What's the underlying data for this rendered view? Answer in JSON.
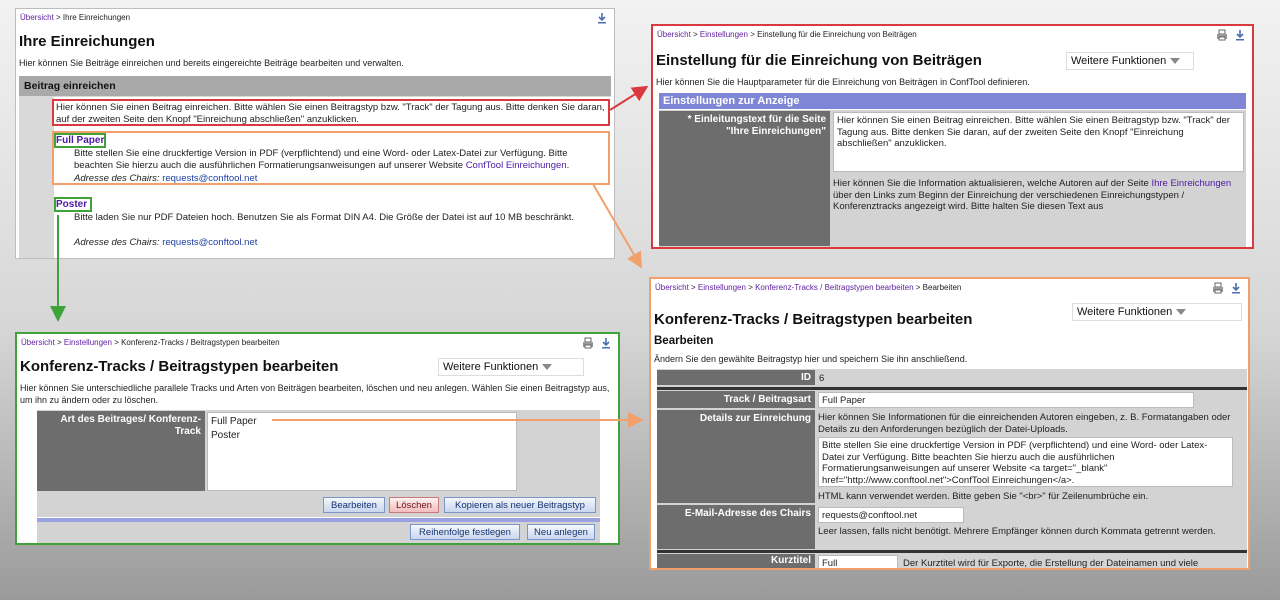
{
  "panel1": {
    "breadcrumb": {
      "home": "Übersicht",
      "current": "Ihre Einreichungen"
    },
    "title": "Ihre Einreichungen",
    "description": "Hier können Sie Beiträge einreichen und bereits eingereichte Beiträge bearbeiten und verwalten.",
    "section_header": "Beitrag einreichen",
    "intro": "Hier können Sie einen Beitrag einreichen. Bitte wählen Sie einen Beitragstyp bzw. \"Track\" der Tagung aus. Bitte denken Sie daran, auf der zweiten Seite den Knopf \"Einreichung abschließen\" anzuklicken.",
    "types": [
      {
        "name": "Full Paper",
        "text": "Bitte stellen Sie eine druckfertige Version in PDF (verpflichtend) und eine Word- oder Latex-Datei zur Verfügung. Bitte beachten Sie hierzu auch die ausführlichen Formatierungsanweisungen auf unserer Website",
        "link": "ConfTool Einreichungen",
        "chair_label": "Adresse des Chairs:",
        "email": "requests@conftool.net"
      },
      {
        "name": "Poster",
        "text": "Bitte laden Sie nur PDF Dateien hoch. Benutzen Sie als Format DIN A4. Die Größe der Datei ist auf 10 MB beschränkt.",
        "chair_label": "Adresse des Chairs:",
        "email": "requests@conftool.net"
      }
    ]
  },
  "panel2": {
    "breadcrumb": {
      "home": "Übersicht",
      "sep": ">",
      "settings": "Einstellungen",
      "current": "Einstellung für die Einreichung von Beiträgen"
    },
    "title": "Einstellung für die Einreichung von Beiträgen",
    "more": "Weitere Funktionen",
    "description": "Hier können Sie die Hauptparameter für die Einreichung von Beiträgen in ConfTool definieren.",
    "section_header": "Einstellungen zur Anzeige",
    "field_label": "* Einleitungstext für die Seite \"Ihre Einreichungen\"",
    "field_value": "Hier können Sie einen Beitrag einreichen. Bitte wählen Sie einen Beitragstyp bzw. \"Track\" der Tagung aus. Bitte denken Sie daran, auf der zweiten Seite den Knopf \"Einreichung abschließen\" anzuklicken.",
    "help_pre": "Hier können Sie die Information aktualisieren, welche Autoren auf der Seite",
    "help_link": "Ihre Einreichungen",
    "help_post": "über den Links zum Beginn der Einreichung der verschiedenen Einreichungstypen / Konferenztracks angezeigt wird. Bitte halten Sie diesen Text aus"
  },
  "panel3": {
    "breadcrumb": {
      "home": "Übersicht",
      "settings": "Einstellungen",
      "current": "Konferenz-Tracks / Beitragstypen bearbeiten"
    },
    "title": "Konferenz-Tracks / Beitragstypen bearbeiten",
    "more": "Weitere Funktionen",
    "description": "Hier können Sie unterschiedliche parallele Tracks und Arten von Beiträgen bearbeiten, löschen und neu anlegen. Wählen Sie einen Beitragstyp aus, um ihn zu ändern oder zu löschen.",
    "list_label": "Art des Beitrages/ Konferenz-Track",
    "list_items": [
      "Full Paper",
      "Poster"
    ],
    "buttons": {
      "edit": "Bearbeiten",
      "delete": "Löschen",
      "copy": "Kopieren als neuer Beitragstyp",
      "order": "Reihenfolge festlegen",
      "new": "Neu anlegen"
    }
  },
  "panel4": {
    "breadcrumb": {
      "home": "Übersicht",
      "settings": "Einstellungen",
      "tracks": "Konferenz-Tracks / Beitragstypen bearbeiten",
      "current": "Bearbeiten"
    },
    "title": "Konferenz-Tracks / Beitragstypen bearbeiten",
    "more": "Weitere Funktionen",
    "subtitle": "Bearbeiten",
    "description": "Ändern Sie den gewählte Beitragstyp hier und speichern Sie ihn anschließend.",
    "id_label": "ID",
    "id_value": "6",
    "track_label": "Track / Beitragsart",
    "track_value": "Full Paper",
    "details_label": "Details zur Einreichung",
    "details_help": "Hier können Sie Informationen für die einreichenden Autoren eingeben, z. B. Formatangaben oder Details zu den Anforderungen bezüglich der Datei-Uploads.",
    "details_value": "Bitte stellen Sie eine druckfertige Version in PDF (verpflichtend) und eine Word- oder Latex-Datei zur Verfügung. Bitte beachten Sie hierzu auch die ausführlichen Formatierungsanweisungen auf unserer Website <a target=\"_blank\" href=\"http://www.conftool.net\">ConfTool Einreichungen</a>.",
    "html_note": "HTML kann verwendet werden. Bitte geben Sie \"<br>\" für Zeilenumbrüche ein.",
    "email_label": "E-Mail-Adresse des Chairs",
    "email_value": "requests@conftool.net",
    "email_help": "Leer lassen, falls nicht benötigt. Mehrere Empfänger können durch Kommata getrennt werden.",
    "short_label": "Kurztitel",
    "short_value": "Full",
    "short_help": "Der Kurztitel wird für Exporte, die Erstellung der Dateinamen und viele"
  },
  "colors": {
    "red": "#d9393f",
    "green": "#3fa33a",
    "orange": "#f1a06b",
    "section_header": "#7f86d6",
    "label_bg": "#6d6d6d",
    "link": "#4b1aa6"
  }
}
